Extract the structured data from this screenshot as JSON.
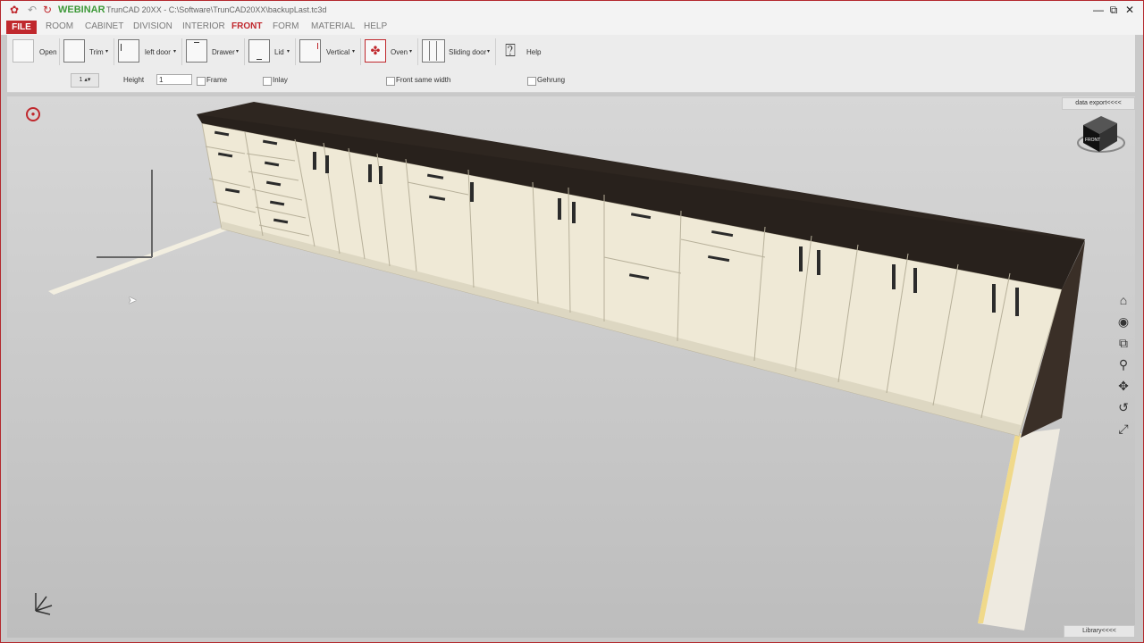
{
  "titlebar": {
    "app_name": "WEBINAR",
    "file_path": "TrunCAD 20XX - C:\\Software\\TrunCAD20XX\\backupLast.tc3d",
    "minimize": "—",
    "maximize": "⧉",
    "close": "✕"
  },
  "menu": {
    "file": "FILE",
    "items": [
      "ROOM",
      "CABINET",
      "DIVISION",
      "INTERIOR",
      "FRONT",
      "FORM",
      "MATERIAL",
      "HELP"
    ],
    "active": "FRONT"
  },
  "toolbar": {
    "open": "Open",
    "trim": "Trim",
    "left_door": "left door",
    "drawer": "Drawer",
    "lid": "Lid",
    "vertical": "Vertical",
    "oven": "Oven",
    "sliding_door": "Sliding door",
    "help": "Help",
    "dropdown_arrow": "▾"
  },
  "options": {
    "spinner_value": "1",
    "height_label": "Height",
    "height_value": "1",
    "frame": "Frame",
    "inlay": "Inlay",
    "front_same_width": "Front same width",
    "gehrung": "Gehrung"
  },
  "viewport": {
    "data_export": "data export<<<<",
    "library": "Library<<<<",
    "view_cube_label": "FRONT"
  },
  "colors": {
    "accent": "#c0282d",
    "brand_green": "#3f9a3a",
    "worktop": "#2e2620",
    "cabinet_front": "#efe9d6"
  }
}
